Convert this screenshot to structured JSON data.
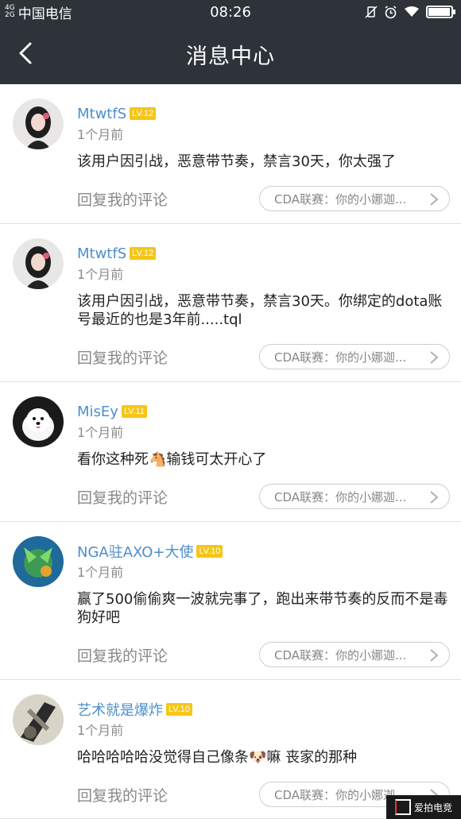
{
  "status_bar": {
    "signal_top": "4G",
    "signal_bottom": "2G",
    "carrier": "中国电信",
    "time": "08:26"
  },
  "header": {
    "title": "消息中心"
  },
  "notifications": [
    {
      "username": "MtwtfS",
      "level": "LV.12",
      "time": "1个月前",
      "message": "该用户因引战，恶意带节奏，禁言30天，你太强了",
      "reply_label": "回复我的评论",
      "source": "CDA联赛：你的小娜迦..."
    },
    {
      "username": "MtwtfS",
      "level": "LV.12",
      "time": "1个月前",
      "message": "该用户因引战，恶意带节奏，禁言30天。你绑定的dota账号最近的也是3年前.....tql",
      "reply_label": "回复我的评论",
      "source": "CDA联赛：你的小娜迦..."
    },
    {
      "username": "MisEy",
      "level": "LV.11",
      "time": "1个月前",
      "message": "看你这种死🐴输钱可太开心了",
      "reply_label": "回复我的评论",
      "source": "CDA联赛：你的小娜迦..."
    },
    {
      "username": "NGA驻AXO+大使",
      "level": "LV.10",
      "time": "1个月前",
      "message": "赢了500偷偷爽一波就完事了，跑出来带节奏的反而不是毒狗好吧",
      "reply_label": "回复我的评论",
      "source": "CDA联赛：你的小娜迦..."
    },
    {
      "username": "艺术就是爆炸",
      "level": "LV.10",
      "time": "1个月前",
      "message": "哈哈哈哈哈没觉得自己像条🐶嘛 丧家的那种",
      "reply_label": "回复我的评论",
      "source": "CDA联赛：你的小娜迦..."
    }
  ],
  "watermark": {
    "text": "爱拍电竞"
  }
}
